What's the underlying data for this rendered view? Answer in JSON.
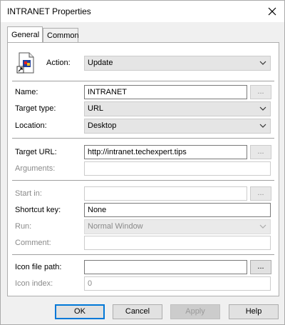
{
  "window": {
    "title": "INTRANET Properties"
  },
  "tabs": [
    {
      "label": "General"
    },
    {
      "label": "Common"
    }
  ],
  "action": {
    "label": "Action:",
    "value": "Update"
  },
  "name": {
    "label": "Name:",
    "value": "INTRANET",
    "browse": "..."
  },
  "target_type": {
    "label": "Target type:",
    "value": "URL"
  },
  "location": {
    "label": "Location:",
    "value": "Desktop"
  },
  "target_url": {
    "label": "Target URL:",
    "value": "http://intranet.techexpert.tips",
    "browse": "..."
  },
  "arguments": {
    "label": "Arguments:",
    "value": ""
  },
  "start_in": {
    "label": "Start in:",
    "value": "",
    "browse": "..."
  },
  "shortcut_key": {
    "label": "Shortcut key:",
    "value": "None"
  },
  "run": {
    "label": "Run:",
    "value": "Normal Window"
  },
  "comment": {
    "label": "Comment:",
    "value": ""
  },
  "icon_file_path": {
    "label": "Icon file path:",
    "value": "",
    "browse": "..."
  },
  "icon_index": {
    "label": "Icon index:",
    "value": "0"
  },
  "buttons": {
    "ok": "OK",
    "cancel": "Cancel",
    "apply": "Apply",
    "help": "Help"
  },
  "colors": {
    "accent": "#0078d7",
    "disabled_text": "#8a8a8a"
  }
}
